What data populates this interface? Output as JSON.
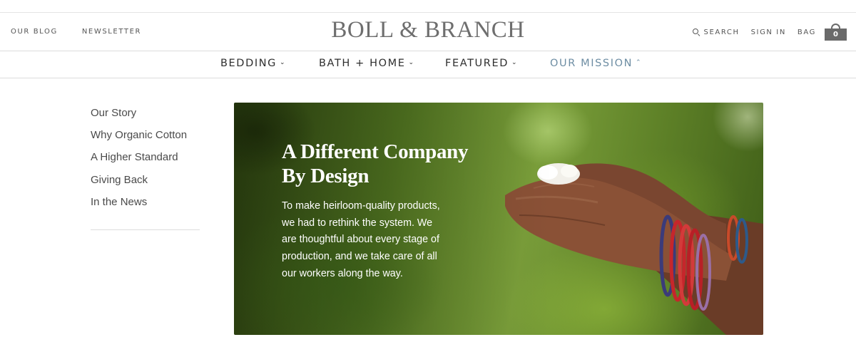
{
  "header": {
    "left_links": [
      "OUR BLOG",
      "NEWSLETTER"
    ],
    "logo": "BOLL & BRANCH",
    "search_label": "SEARCH",
    "sign_in_label": "SIGN IN",
    "bag_label": "BAG",
    "bag_count": "0"
  },
  "nav": {
    "items": [
      {
        "label": "BEDDING",
        "chevron": "⌄",
        "active": false
      },
      {
        "label": "BATH + HOME",
        "chevron": "⌄",
        "active": false
      },
      {
        "label": "FEATURED",
        "chevron": "⌄",
        "active": false
      },
      {
        "label": "OUR MISSION",
        "chevron": "⌃",
        "active": true
      }
    ],
    "active_color": "#6d8da3"
  },
  "mission_menu": {
    "items": [
      "Our Story",
      "Why Organic Cotton",
      "A Higher Standard",
      "Giving Back",
      "In the News"
    ]
  },
  "hero": {
    "title": "A Different Company By Design",
    "body": "To make heirloom-quality products, we had to rethink the system. We are thoughtful about every stage of production, and we take care of all our workers along the way."
  }
}
